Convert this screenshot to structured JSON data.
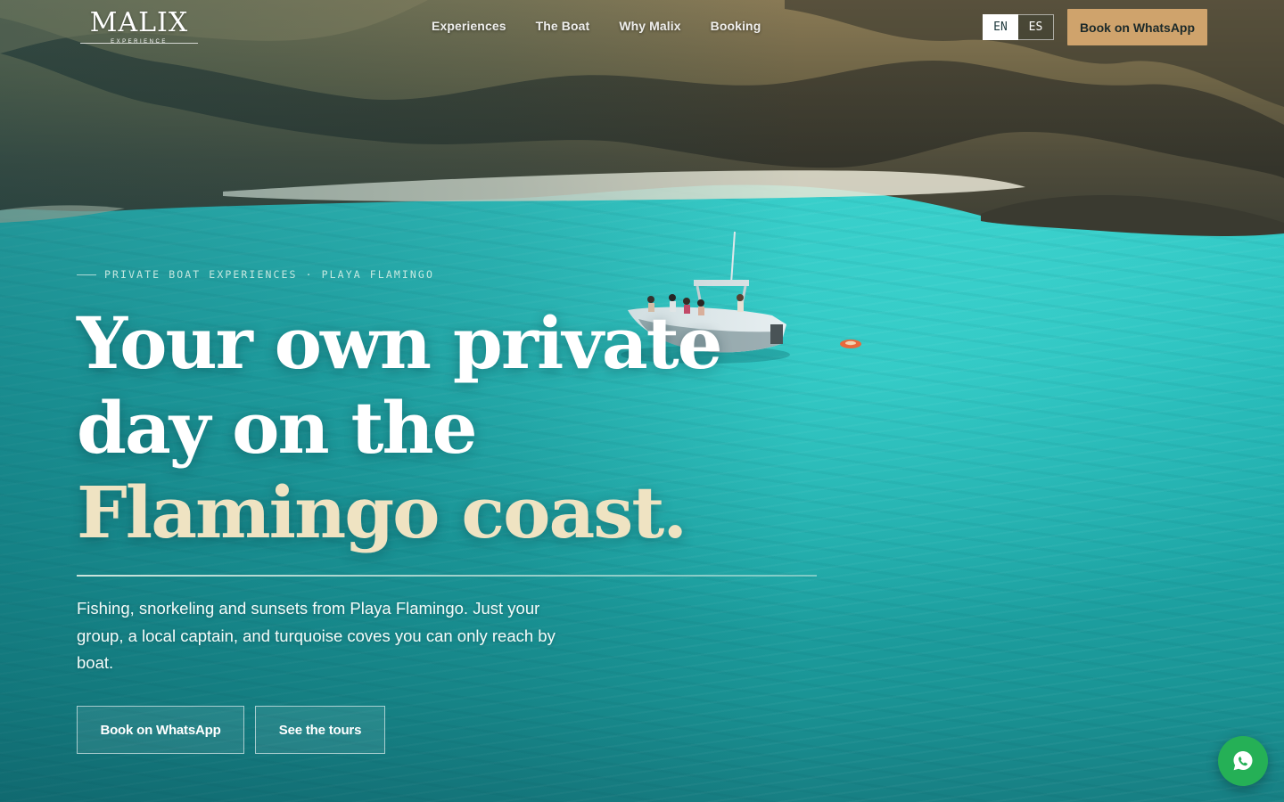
{
  "brand": {
    "logo_word": "MALIX",
    "logo_tag": "EXPERIENCE"
  },
  "nav": {
    "items": [
      "Experiences",
      "The Boat",
      "Why Malix",
      "Booking"
    ]
  },
  "language": {
    "options": [
      "EN",
      "ES"
    ],
    "selected": "EN"
  },
  "header_cta": "Book on WhatsApp",
  "hero": {
    "eyebrow": "PRIVATE BOAT EXPERIENCES · PLAYA FLAMINGO",
    "headline_part1": "Your own private day on the ",
    "headline_accent": "Flamingo coast.",
    "lede": "Fishing, snorkeling and sunsets from Playa Flamingo. Just your group, a local captain, and turquoise coves you can only reach by boat.",
    "primary_button": "Book on WhatsApp",
    "secondary_button": "See the tours"
  },
  "floating": {
    "icon": "whatsapp-icon"
  },
  "colors": {
    "accent": "#cfa36c",
    "headline_accent": "#efe3c2",
    "whatsapp": "#25b056",
    "sea": "#1ea6a6"
  }
}
